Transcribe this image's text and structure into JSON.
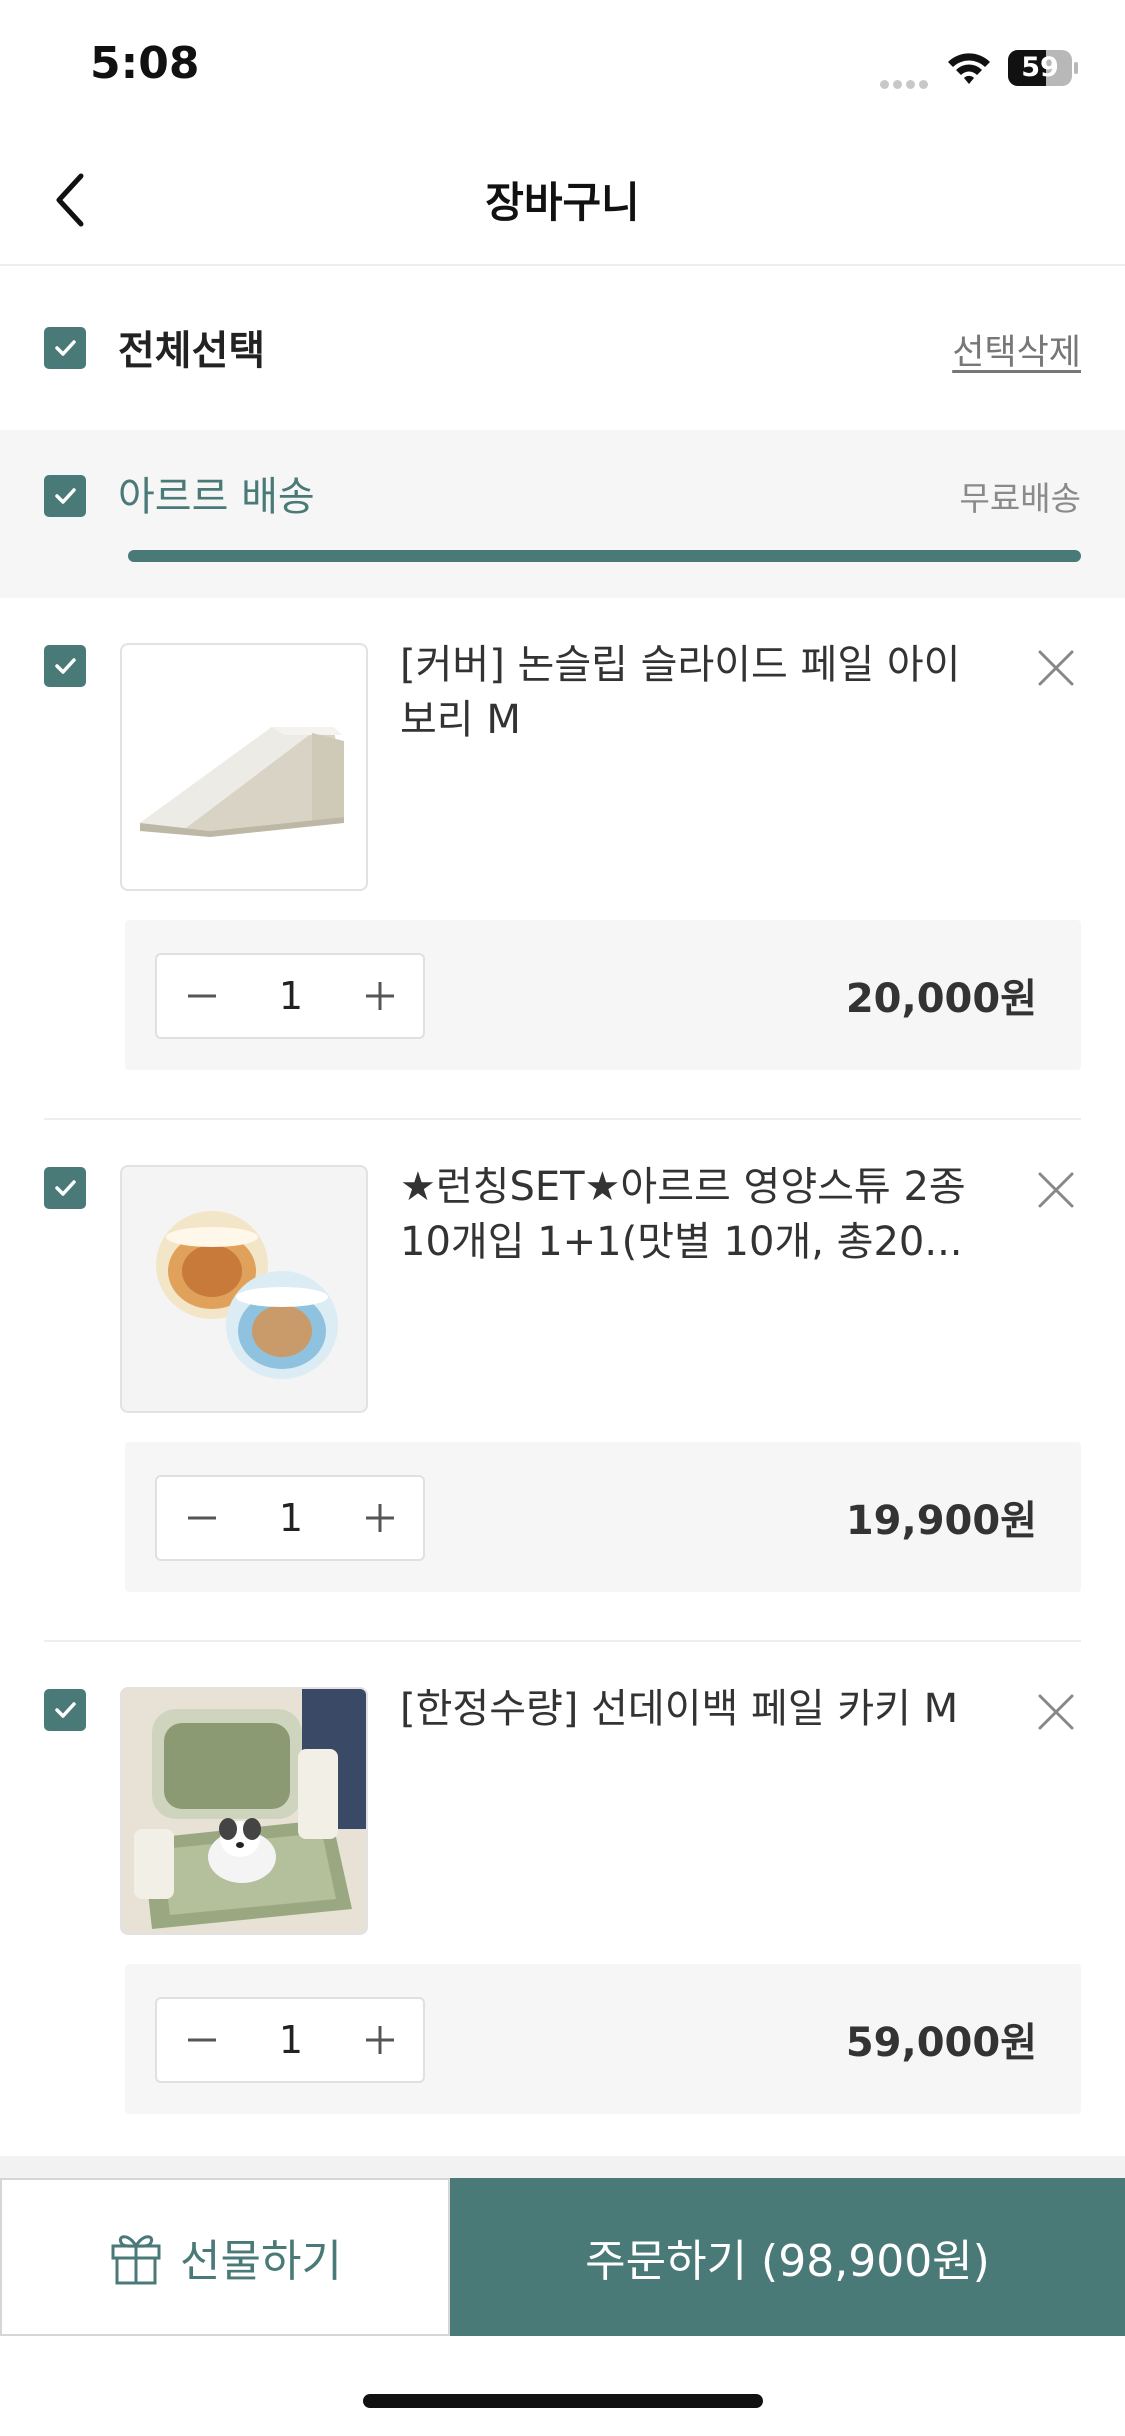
{
  "status_bar": {
    "time": "5:08",
    "battery": "59",
    "battery_level": 0.59
  },
  "nav": {
    "title": "장바구니",
    "back_icon": "chevron-left-icon"
  },
  "select_all": {
    "label": "전체선택",
    "checked": true,
    "delete_label": "선택삭제"
  },
  "shipping_group": {
    "label": "아르르 배송",
    "badge": "무료배송",
    "checked": true,
    "progress": 1.0
  },
  "items": [
    {
      "name": "[커버] 논슬립 슬라이드 페일 아이보리 M",
      "quantity": "1",
      "price": "20,000원",
      "checked": true
    },
    {
      "name": "★런칭SET★아르르 영양스튜 2종 10개입 1+1(맛별 10개, 총20...",
      "quantity": "1",
      "price": "19,900원",
      "checked": true
    },
    {
      "name": "[한정수량] 선데이백 페일 카키 M",
      "quantity": "1",
      "price": "59,000원",
      "checked": true
    }
  ],
  "bottom": {
    "gift_label": "선물하기",
    "order_label": "주문하기 (98,900원)"
  },
  "colors": {
    "accent": "#4a7a78",
    "background": "#ffffff",
    "panel": "#f6f6f6"
  }
}
